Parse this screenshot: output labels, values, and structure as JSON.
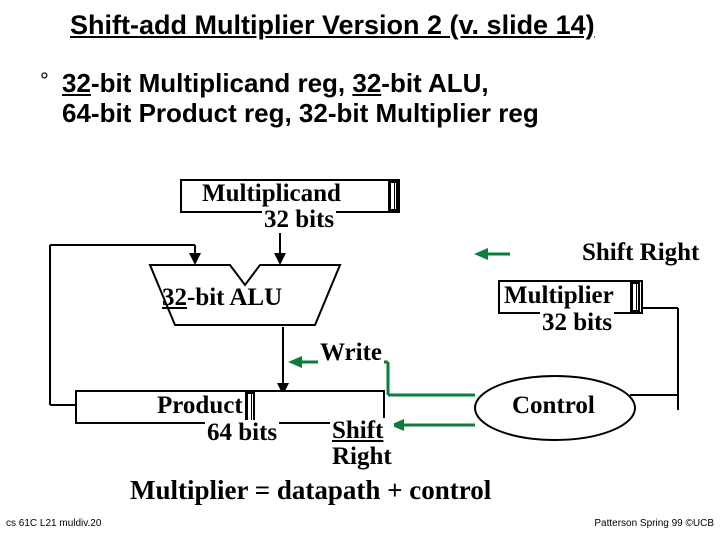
{
  "title": "Shift-add Multiplier Version 2 (v. slide 14)",
  "bullet": {
    "mark": "°",
    "line1_a": "32",
    "line1_b": "-bit Multiplicand reg, ",
    "line1_c": "32",
    "line1_d": "-bit ALU,",
    "line2": "64-bit Product reg, 32-bit Multiplier reg"
  },
  "diagram": {
    "multiplicand": "Multiplicand",
    "multiplicand_bits": "32 bits",
    "alu_a": "32",
    "alu_b": "-bit ALU",
    "write": "Write",
    "product": "Product",
    "product_bits": "64 bits",
    "shift_right_prod_a": "Shift",
    "shift_right_prod_b": "Right",
    "multiplier": "Multiplier",
    "multiplier_bits": "32 bits",
    "shift_right_mult": "Shift Right",
    "control": "Control"
  },
  "equation": "Multiplier = datapath + control",
  "footer_left": "cs 61C L21 muldiv.20",
  "footer_right": "Patterson Spring 99 ©UCB"
}
